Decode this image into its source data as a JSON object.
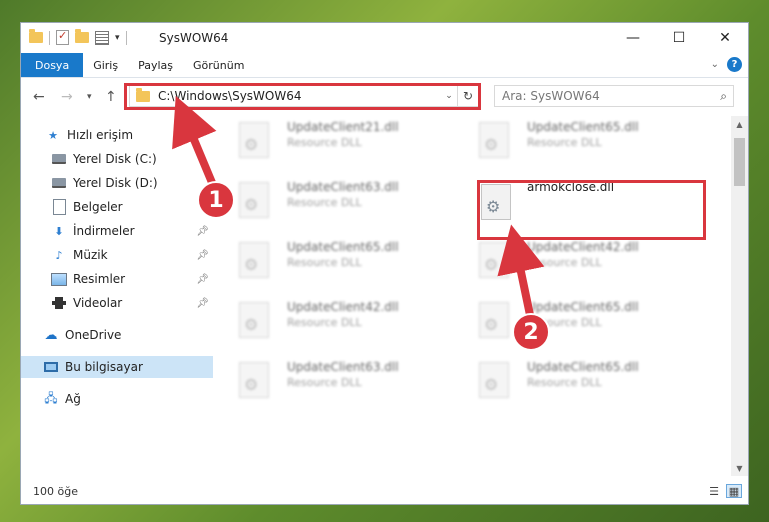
{
  "window": {
    "title": "SysWOW64",
    "controls": {
      "minimize": "—",
      "maximize": "☐",
      "close": "✕"
    }
  },
  "ribbon": {
    "tabs": [
      "Dosya",
      "Giriş",
      "Paylaş",
      "Görünüm"
    ]
  },
  "navigation": {
    "address": "C:\\Windows\\SysWOW64",
    "search_placeholder": "Ara: SysWOW64"
  },
  "sidebar": {
    "items": [
      {
        "label": "Hızlı erişim",
        "icon": "star-icon"
      },
      {
        "label": "Yerel Disk (C:)",
        "icon": "disk-icon"
      },
      {
        "label": "Yerel Disk (D:)",
        "icon": "disk-icon"
      },
      {
        "label": "Belgeler",
        "icon": "document-icon"
      },
      {
        "label": "İndirmeler",
        "icon": "download-icon",
        "pinned": true
      },
      {
        "label": "Müzik",
        "icon": "music-icon",
        "pinned": true
      },
      {
        "label": "Resimler",
        "icon": "picture-icon",
        "pinned": true
      },
      {
        "label": "Videolar",
        "icon": "video-icon",
        "pinned": true
      },
      {
        "label": "OneDrive",
        "icon": "cloud-icon"
      },
      {
        "label": "Bu bilgisayar",
        "icon": "computer-icon",
        "selected": true
      },
      {
        "label": "Ağ",
        "icon": "network-icon"
      }
    ]
  },
  "files": [
    {
      "name": "UpdateClient21.dll",
      "type": "Resource DLL",
      "blurred": true
    },
    {
      "name": "UpdateClient65.dll",
      "type": "Resource DLL",
      "blurred": true
    },
    {
      "name": "UpdateClient63.dll",
      "type": "Resource DLL",
      "blurred": true
    },
    {
      "name": "armokclose.dll",
      "type": "",
      "blurred": false
    },
    {
      "name": "UpdateClient65.dll",
      "type": "Resource DLL",
      "blurred": true
    },
    {
      "name": "UpdateClient42.dll",
      "type": "Resource DLL",
      "blurred": true
    },
    {
      "name": "UpdateClient42.dll",
      "type": "Resource DLL",
      "blurred": true
    },
    {
      "name": "UpdateClient65.dll",
      "type": "Resource DLL",
      "blurred": true
    },
    {
      "name": "UpdateClient63.dll",
      "type": "Resource DLL",
      "blurred": true
    },
    {
      "name": "UpdateClient65.dll",
      "type": "Resource DLL",
      "blurred": true
    }
  ],
  "status": {
    "item_count": "100 öğe"
  },
  "annotations": {
    "marker_1": "1",
    "marker_2": "2",
    "color": "#d9363e"
  },
  "colors": {
    "accent": "#1979ca",
    "selection": "#cce4f7"
  }
}
